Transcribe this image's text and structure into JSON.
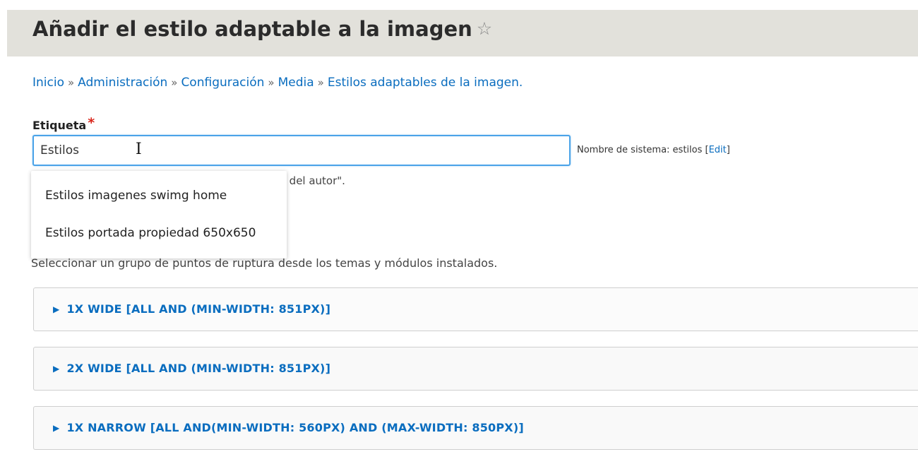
{
  "header": {
    "title": "Añadir el estilo adaptable a la imagen",
    "star_icon": "☆"
  },
  "breadcrumb": {
    "items": [
      "Inicio",
      "Administración",
      "Configuración",
      "Media",
      "Estilos adaptables de la imagen."
    ],
    "separator": "»"
  },
  "form": {
    "label": {
      "text": "Etiqueta",
      "required_mark": "*"
    },
    "input": {
      "value": "Estilos"
    },
    "machine_name": {
      "prefix": "Nombre de sistema: estilos [",
      "edit_label": "Edit",
      "suffix": "]"
    },
    "description_partial": "jen del autor\".",
    "autocomplete": {
      "options": [
        "Estilos imagenes swimg home",
        "Estilos portada propiedad 650x650"
      ]
    },
    "breakpoint_description": "Seleccionar un grupo de puntos de ruptura desde los temas y módulos instalados."
  },
  "breakpoints": [
    {
      "label": "1X WIDE [ALL AND (MIN-WIDTH: 851PX)]"
    },
    {
      "label": "2X WIDE [ALL AND (MIN-WIDTH: 851PX)]"
    },
    {
      "label": "1X NARROW [ALL AND(MIN-WIDTH: 560PX) AND (MAX-WIDTH: 850PX)]"
    }
  ],
  "icons": {
    "triangle": "▶",
    "cursor": "I"
  },
  "colors": {
    "link": "#0a6dbf",
    "required": "#d9261c",
    "focus_border": "#4aa3e8",
    "title_bar": "#e2e1db"
  }
}
